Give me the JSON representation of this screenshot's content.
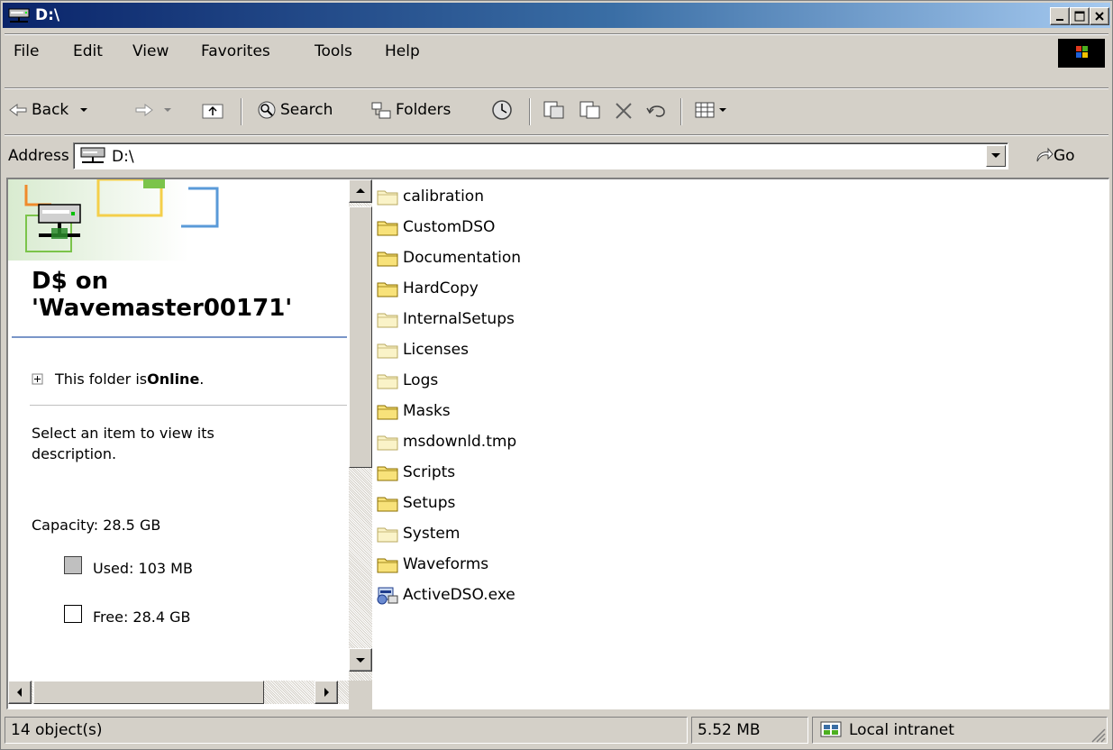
{
  "window": {
    "title": "D:\\"
  },
  "menu": [
    "File",
    "Edit",
    "View",
    "Favorites",
    "Tools",
    "Help"
  ],
  "toolbar": {
    "back_label": "Back",
    "search_label": "Search",
    "folders_label": "Folders"
  },
  "address": {
    "label": "Address",
    "value": "D:\\",
    "go_label": "Go"
  },
  "left_pane": {
    "drive_title_line1": "D$ on",
    "drive_title_line2": "'Wavemaster00171'",
    "status_prefix": "This folder is ",
    "status_value": "Online",
    "status_suffix": ".",
    "description_hint": "Select an item to view its description.",
    "capacity": "Capacity: 28.5 GB",
    "used": "Used: 103 MB",
    "free": "Free: 28.4 GB"
  },
  "files": [
    {
      "name": "calibration",
      "icon": "folder-hidden-icon"
    },
    {
      "name": "CustomDSO",
      "icon": "folder-icon"
    },
    {
      "name": "Documentation",
      "icon": "folder-icon"
    },
    {
      "name": "HardCopy",
      "icon": "folder-icon"
    },
    {
      "name": "InternalSetups",
      "icon": "folder-hidden-icon"
    },
    {
      "name": "Licenses",
      "icon": "folder-hidden-icon"
    },
    {
      "name": "Logs",
      "icon": "folder-hidden-icon"
    },
    {
      "name": "Masks",
      "icon": "folder-icon"
    },
    {
      "name": "msdownld.tmp",
      "icon": "folder-hidden-icon"
    },
    {
      "name": "Scripts",
      "icon": "folder-icon"
    },
    {
      "name": "Setups",
      "icon": "folder-icon"
    },
    {
      "name": "System",
      "icon": "folder-hidden-icon"
    },
    {
      "name": "Waveforms",
      "icon": "folder-icon"
    },
    {
      "name": "ActiveDSO.exe",
      "icon": "application-icon"
    }
  ],
  "status_bar": {
    "objects": "14 object(s)",
    "size": "5.52 MB",
    "zone": "Local intranet"
  },
  "colors": {
    "title_start": "#0a246a",
    "title_end": "#a6caf0",
    "chrome": "#d4d0c8",
    "folder": "#f8e27a"
  }
}
